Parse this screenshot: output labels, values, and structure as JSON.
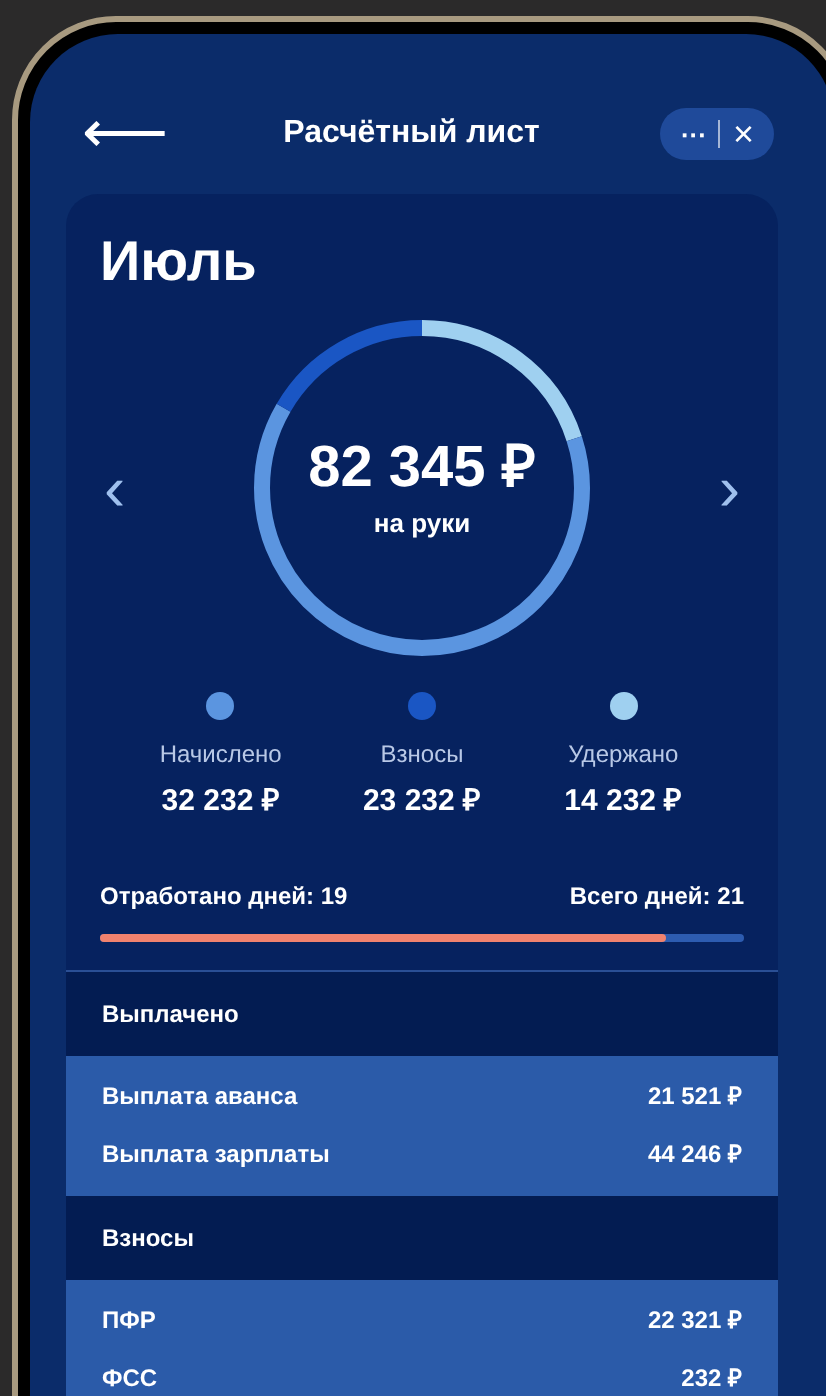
{
  "header": {
    "back": "⟵",
    "title": "Расчётный лист",
    "menu": "···",
    "close": "×"
  },
  "summary": {
    "month": "Июль",
    "total": "82 345 ₽",
    "total_caption": "на руки",
    "prev": "‹",
    "next": "›",
    "legend": [
      {
        "label": "Начислено",
        "value": "32 232 ₽",
        "color": "#5b95e0"
      },
      {
        "label": "Взносы",
        "value": "23 232 ₽",
        "color": "#1a56c4"
      },
      {
        "label": "Удержано",
        "value": "14 232 ₽",
        "color": "#9fd0f0"
      }
    ],
    "days": {
      "worked": "Отработано дней: 19",
      "total": "Всего дней: 21",
      "level": 0.88
    }
  },
  "sections": [
    {
      "title": "Выплачено",
      "rows": [
        {
          "label": "Выплата аванса",
          "value": "21 521 ₽"
        },
        {
          "label": "Выплата зарплаты",
          "value": "44 246 ₽"
        }
      ]
    },
    {
      "title": "Взносы",
      "rows": [
        {
          "label": "ПФР",
          "value": "22 321 ₽"
        },
        {
          "label": "ФСС",
          "value": "232 ₽"
        }
      ]
    }
  ]
}
